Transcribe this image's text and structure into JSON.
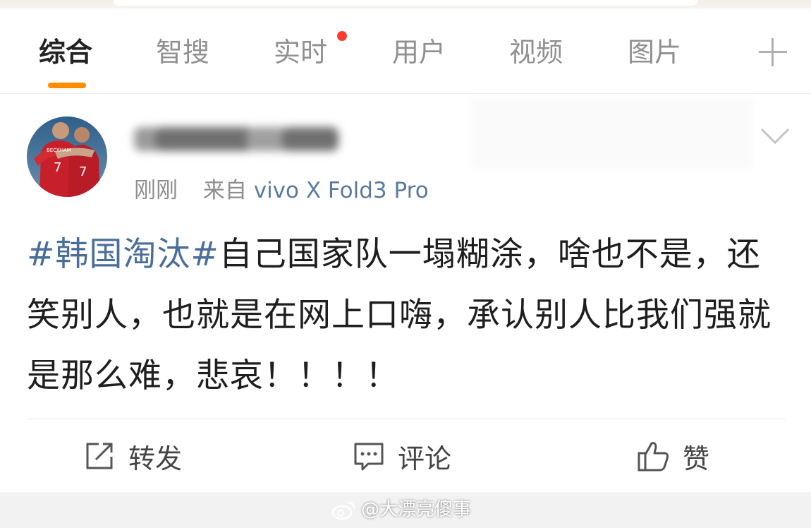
{
  "tabs": [
    {
      "label": "综合",
      "active": true
    },
    {
      "label": "智搜",
      "active": false
    },
    {
      "label": "实时",
      "active": false,
      "badge_dot": true
    },
    {
      "label": "用户",
      "active": false
    },
    {
      "label": "视频",
      "active": false
    },
    {
      "label": "图片",
      "active": false
    }
  ],
  "tabs_more_icon": "plus-icon",
  "post": {
    "avatar_icon": "avatar",
    "avatar_jersey_text": "BECKHAM",
    "avatar_jersey_number": "7",
    "username_blurred": true,
    "time": "刚刚",
    "source_prefix": "来自",
    "device": "vivo X Fold3 Pro",
    "hashtag": "#韩国淘汰#",
    "text": "自己国家队一塌糊涂，啥也不是，还笑别人，也就是在网上口嗨，承认别人比我们强就是那么难，悲哀！！！！",
    "menu_icon": "chevron-down-icon"
  },
  "actions": {
    "repost_label": "转发",
    "comment_label": "评论",
    "like_label": "赞"
  },
  "watermark": "@大漂亮傻事",
  "colors": {
    "accent": "#ff8c00",
    "hashtag": "#4a6e9a",
    "badge": "#ff3b30",
    "device": "#5a7a9e"
  }
}
